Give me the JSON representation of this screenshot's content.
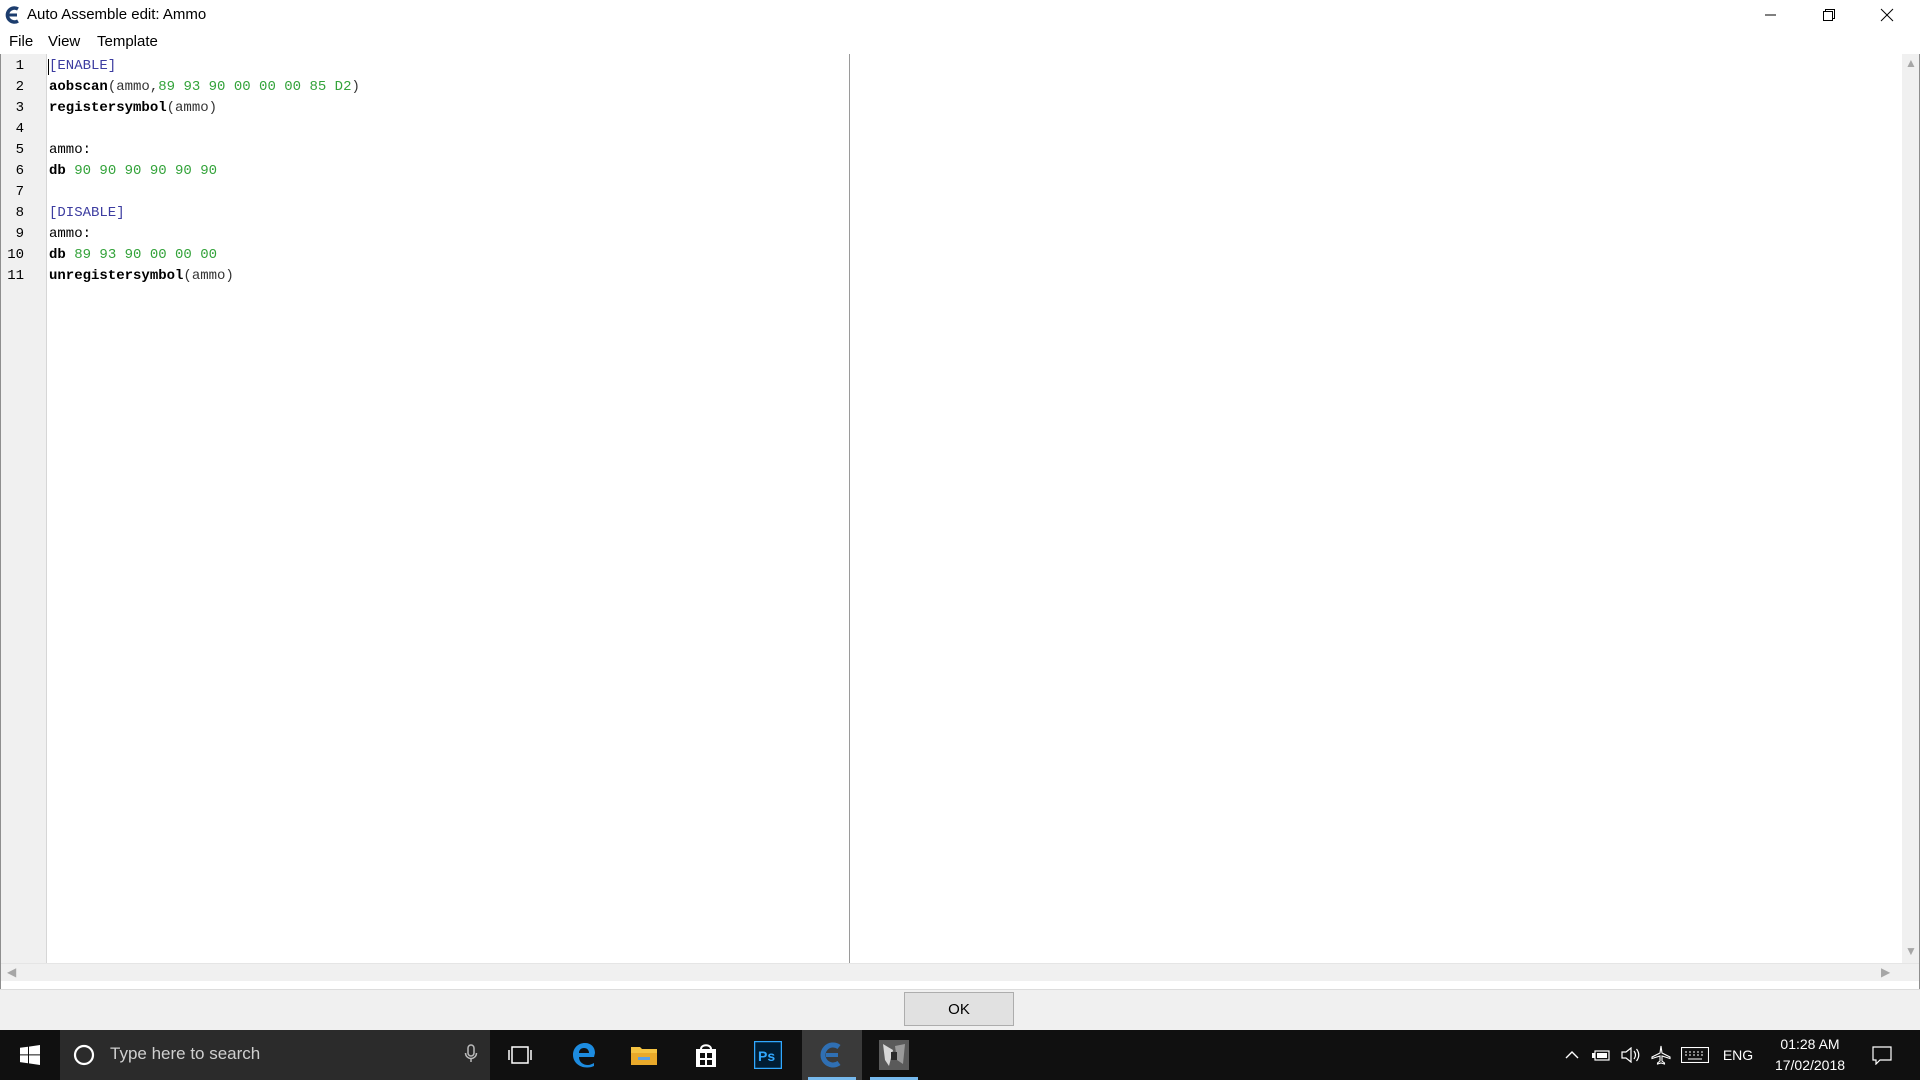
{
  "window": {
    "title": "Auto Assemble edit: Ammo"
  },
  "menu": {
    "items": [
      "File",
      "View",
      "Template"
    ]
  },
  "editor": {
    "line_numbers": [
      "1",
      "2",
      "3",
      "4",
      "5",
      "6",
      "7",
      "8",
      "9",
      "10",
      "11"
    ],
    "lines": {
      "l1": "[ENABLE]",
      "l2a": "aobscan",
      "l2b": "(ammo,",
      "l2c": "89 93 90 00 00 00 85 D2",
      "l2d": ")",
      "l3a": "registersymbol",
      "l3b": "(ammo)",
      "l5": "ammo:",
      "l6a": "db",
      "l6b": "90 90 90 90 90 90",
      "l8": "[DISABLE]",
      "l9": "ammo:",
      "l10a": "db",
      "l10b": "89 93 90 00 00 00",
      "l11a": "unregistersymbol",
      "l11b": "(ammo)"
    }
  },
  "buttons": {
    "ok": "OK"
  },
  "taskbar": {
    "search_placeholder": "Type here to search",
    "language": "ENG",
    "time": "01:28 AM",
    "date": "17/02/2018"
  },
  "colors": {
    "keyword_bracket": "#3c3ca0",
    "hex_value": "#33a33a",
    "taskbar_bg": "#101010",
    "taskbar_accent": "#76b9ed"
  }
}
